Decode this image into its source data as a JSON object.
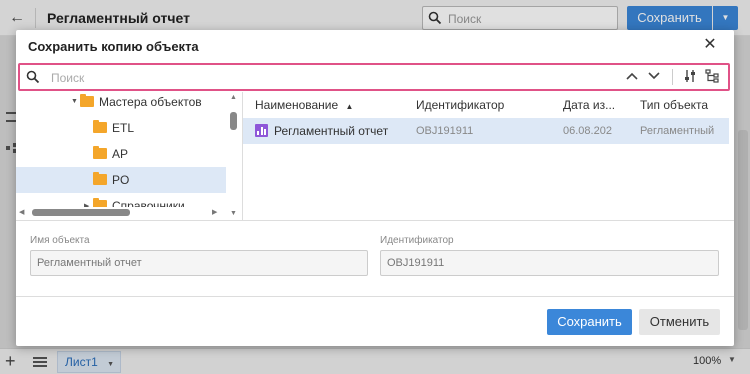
{
  "app": {
    "title": "Регламентный отчет",
    "search_placeholder": "Поиск",
    "save_label": "Сохранить",
    "sheet_tab": "Лист1",
    "zoom": "100%"
  },
  "dialog": {
    "title": "Сохранить копию объекта",
    "search_placeholder": "Поиск",
    "tree": [
      {
        "label": "Мастера объектов",
        "expanded": true,
        "selected": false
      },
      {
        "label": "ETL",
        "expanded": false,
        "selected": false
      },
      {
        "label": "AP",
        "expanded": false,
        "selected": false
      },
      {
        "label": "PO",
        "expanded": false,
        "selected": true
      },
      {
        "label": "Справочники",
        "expanded": false,
        "selected": false
      }
    ],
    "table": {
      "columns": [
        "Наименование",
        "Идентификатор",
        "Дата из...",
        "Тип объекта"
      ],
      "sort_column": "Наименование",
      "rows": [
        {
          "name": "Регламентный отчет",
          "id": "OBJ191911",
          "date": "06.08.202",
          "type": "Регламентный"
        }
      ]
    },
    "fields": {
      "name_label": "Имя объекта",
      "name_value": "Регламентный отчет",
      "id_label": "Идентификатор",
      "id_value": "OBJ191911"
    },
    "save_label": "Сохранить",
    "cancel_label": "Отменить"
  },
  "colors": {
    "accent": "#3b87d9",
    "highlight_border": "#e05287",
    "selection": "#dde8f6",
    "folder": "#f4a62a",
    "report_icon": "#8e56d8"
  }
}
